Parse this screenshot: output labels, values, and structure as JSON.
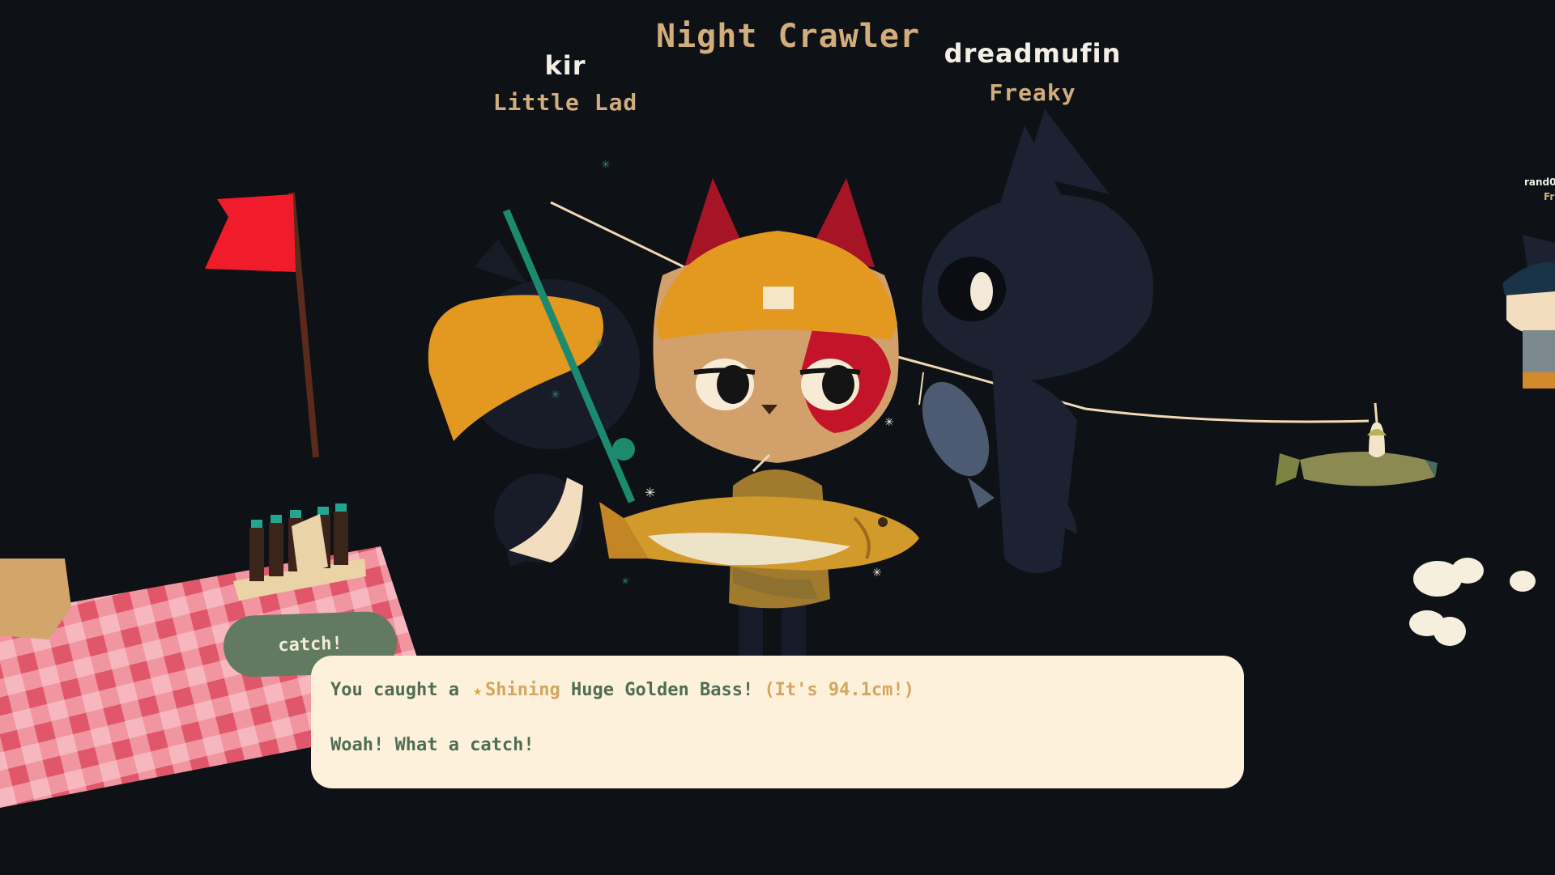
{
  "hud": {
    "bait_title": "Night Crawler",
    "players": [
      {
        "name": "kir",
        "title": "Little Lad"
      },
      {
        "name": "dreadmufin",
        "title": "Freaky"
      }
    ],
    "offscreen_player": {
      "name": "rand0",
      "title": "Fr"
    }
  },
  "catch_button": {
    "label": "catch!"
  },
  "dialog": {
    "line1": {
      "prefix": "You caught a",
      "star_icon": "star-icon",
      "quality": "Shining",
      "fish": "Huge Golden Bass!",
      "size": "(It's 94.1cm!)"
    },
    "line2": "Woah! What a catch!"
  },
  "colors": {
    "background": "#0e1116",
    "title_tan": "#d2ad7c",
    "dialog_bg": "#fdf1db",
    "dialog_text": "#4f6d55",
    "button_green": "#617a61",
    "flag_red": "#f01c2c",
    "beanie_orange": "#e3981f",
    "cheek_red": "#c3142a"
  }
}
